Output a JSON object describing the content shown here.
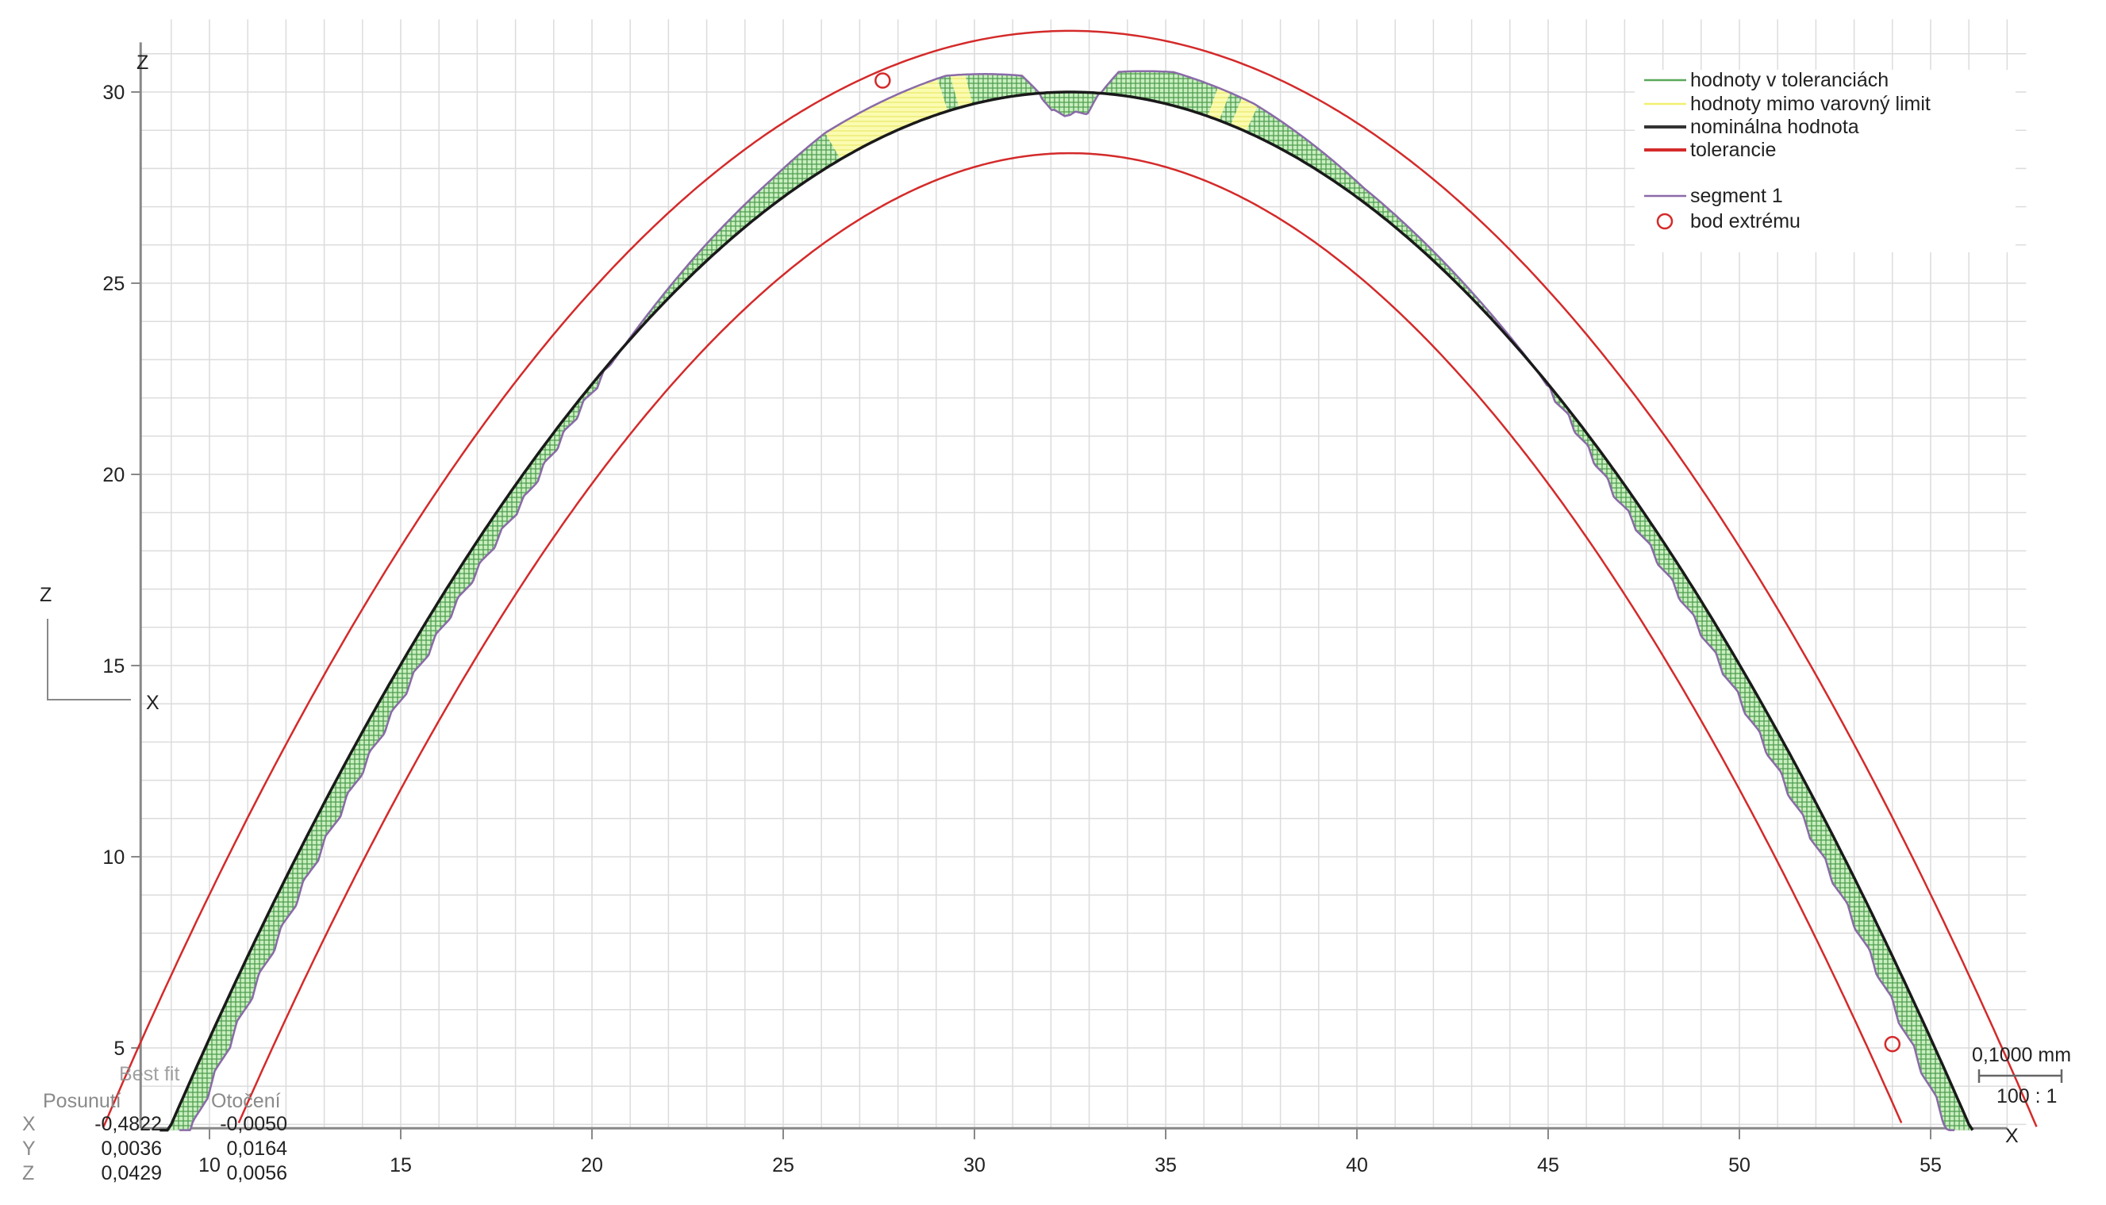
{
  "chart_data": {
    "type": "line",
    "title": "",
    "xlabel": "X",
    "ylabel": "Z",
    "xlim": [
      8.2,
      57.5
    ],
    "ylim": [
      2.9,
      31.9
    ],
    "grid": true,
    "grid_step": 1,
    "x_ticks": [
      "10",
      "15",
      "20",
      "25",
      "30",
      "35",
      "40",
      "45",
      "50",
      "55"
    ],
    "x_tick_values": [
      10,
      15,
      20,
      25,
      30,
      35,
      40,
      45,
      50,
      55
    ],
    "z_ticks": [
      "5",
      "10",
      "15",
      "20",
      "25",
      "30"
    ],
    "z_tick_values": [
      5,
      10,
      15,
      20,
      25,
      30
    ],
    "legend_position": "top-right",
    "legend": [
      {
        "label": "hodnoty v toleranciách",
        "color": "#5aa85a"
      },
      {
        "label": "hodnoty mimo  varovný limit",
        "color": "#f0f070"
      },
      {
        "label": "nominálna hodnota",
        "color": "#333333"
      },
      {
        "label": "tolerancie",
        "color": "#d42a2a"
      },
      {
        "label": "segment 1",
        "color": "#8a6aa8"
      },
      {
        "label": "bod extrému",
        "color": "#d42a2a"
      }
    ],
    "nominal": {
      "peak_x": 32.5,
      "peak_z": 30,
      "half_width": 23.5,
      "drop": 27,
      "x_range": [
        8.7,
        56.1
      ]
    },
    "tolerance_offset": 1.6,
    "deviation_profile": [
      [
        8.7,
        -0.55
      ],
      [
        12,
        -0.5
      ],
      [
        18,
        -0.4
      ],
      [
        20.8,
        0
      ],
      [
        23,
        0.3
      ],
      [
        25,
        0.55
      ],
      [
        26.5,
        0.8
      ],
      [
        29.5,
        0.9
      ],
      [
        31.3,
        0.5
      ],
      [
        31.7,
        0
      ],
      [
        32.0,
        -0.5
      ],
      [
        32.5,
        -0.6
      ],
      [
        33.0,
        -0.5
      ],
      [
        33.3,
        0
      ],
      [
        33.7,
        0.6
      ],
      [
        35,
        0.85
      ],
      [
        37,
        0.75
      ],
      [
        40,
        0.3
      ],
      [
        44.7,
        0
      ],
      [
        47,
        -0.35
      ],
      [
        52,
        -0.5
      ],
      [
        56.1,
        -0.55
      ]
    ],
    "warning_ranges": [
      [
        26.5,
        29.3
      ],
      [
        29.6,
        29.95
      ],
      [
        36.1,
        36.4
      ],
      [
        36.7,
        37.1
      ]
    ],
    "extreme_points": [
      [
        27.6,
        30.3
      ],
      [
        54.0,
        5.1
      ]
    ]
  },
  "axes": {
    "z_label": "Z",
    "x_label": "X"
  },
  "orientation": {
    "z": "Z",
    "x": "X"
  },
  "best_fit": {
    "title": "Best fit",
    "col_shift": "Posunutí",
    "col_rotation": "Otočení",
    "rows": [
      {
        "axis": "X",
        "shift": "-0,4822",
        "rotation": "-0,0050"
      },
      {
        "axis": "Y",
        "shift": "0,0036",
        "rotation": "0,0164"
      },
      {
        "axis": "Z",
        "shift": "0,0429",
        "rotation": "0,0056"
      }
    ]
  },
  "scale": {
    "length": "0,1000 mm",
    "ratio": "100 : 1"
  },
  "colors": {
    "green": "#5aa85a",
    "green_fill": "#c9efc0",
    "yellow": "#f4f48a",
    "red": "#d42a2a",
    "nominal": "#1a1a1a",
    "segment": "#8a6aa8",
    "grid": "#dcdcdc"
  }
}
